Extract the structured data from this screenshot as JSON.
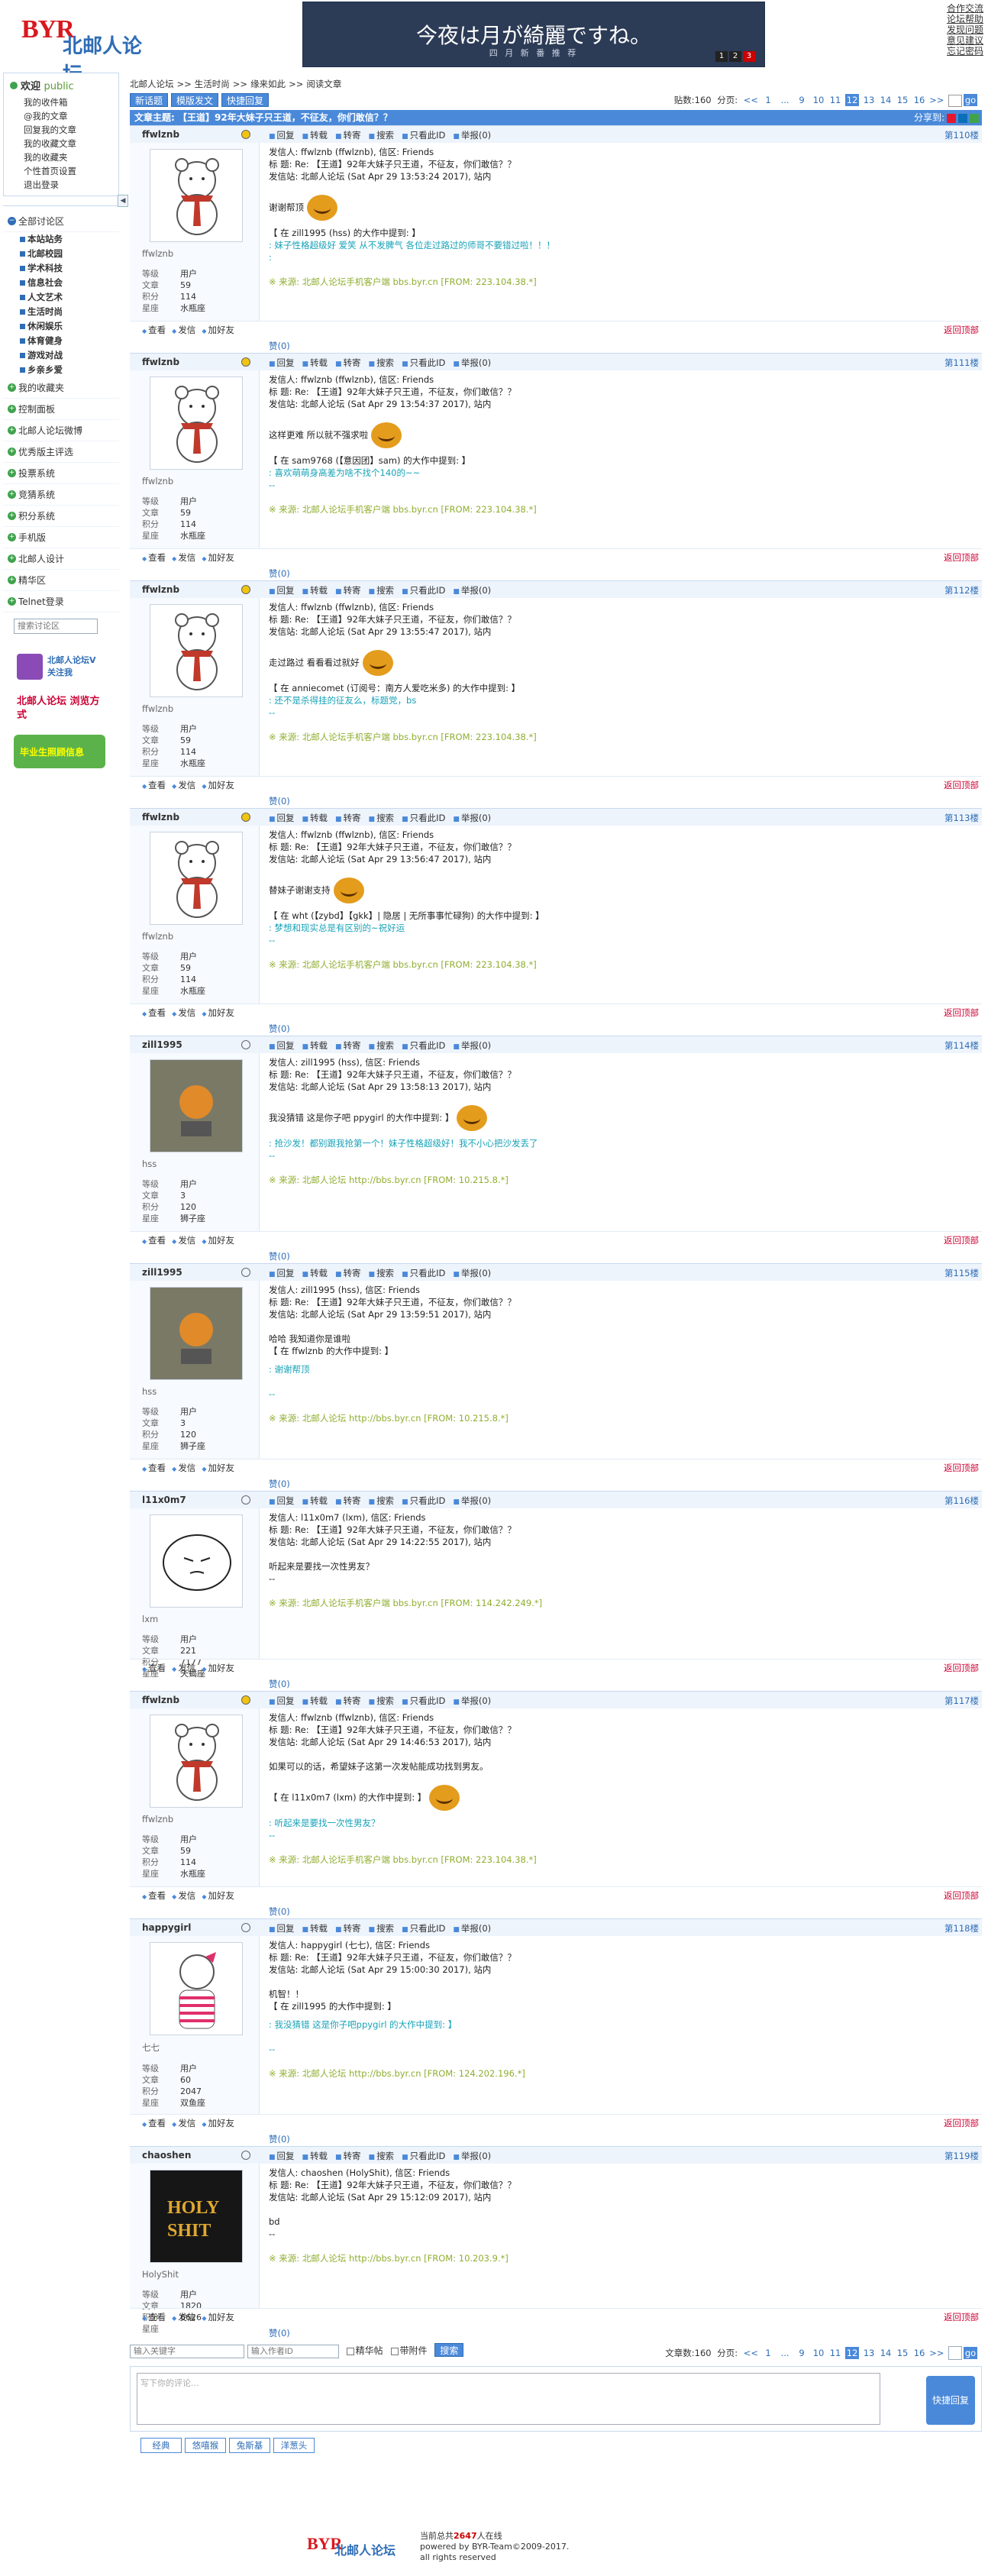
{
  "header": {
    "logo_text": "BYR",
    "logo_cn": "北邮人论坛",
    "banner_title": "今夜は月が綺麗ですね。",
    "banner_sub": "四 月 新 番 推 荐",
    "banner_pages": [
      "1",
      "2",
      "3"
    ],
    "top_links": [
      "合作交流",
      "论坛帮助",
      "发现问题",
      "意见建议",
      "忘记密码"
    ]
  },
  "sidebar": {
    "welcome": "欢迎",
    "user": "public",
    "user_menu": [
      "我的收件箱",
      "@我的文章",
      "回复我的文章",
      "我的收藏文章",
      "我的收藏夹",
      "个性首页设置",
      "退出登录"
    ],
    "collapse": "◀",
    "nav_all": "全部讨论区",
    "sections": [
      "本站站务",
      "北邮校园",
      "学术科技",
      "信息社会",
      "人文艺术",
      "生活时尚",
      "休闲娱乐",
      "体育健身",
      "游戏对战",
      "乡亲乡爱"
    ],
    "nav_items": [
      "我的收藏夹",
      "控制面板",
      "北邮人论坛微博",
      "优秀版主评选",
      "投票系统",
      "竞猜系统",
      "积分系统",
      "手机版",
      "北邮人设计",
      "精华区",
      "Telnet登录"
    ],
    "search_placeholder": "搜索讨论区",
    "promos": [
      "北邮人论坛V 关注我",
      "北邮人论坛 浏览方式",
      "毕业生照顾信息"
    ]
  },
  "main": {
    "breadcrumb": [
      "北邮人论坛",
      ">>",
      "生活时尚",
      ">>",
      "缘来如此",
      ">>",
      "阅读文章"
    ],
    "buttons": [
      "新话题",
      "模版发文",
      "快捷回复"
    ],
    "post_count": "贴数:160",
    "paging_label": "分页:",
    "pages": [
      "<<",
      "1",
      "...",
      "9",
      "10",
      "11",
      "12",
      "13",
      "14",
      "15",
      "16",
      ">>"
    ],
    "current_page": "12",
    "go": "go",
    "title_prefix": "文章主题:",
    "title": "【王道】92年大妹子只王道，不征友，你们敢信？？",
    "share_label": "分享到:",
    "action_labels": [
      "回复",
      "转载",
      "转寄",
      "搜索",
      "只看此ID",
      "举报(0)"
    ],
    "foot_links": [
      "查看",
      "发信",
      "加好友"
    ],
    "like_label": "赞(0)",
    "to_top": "返回顶部",
    "prop_labels": [
      "等级",
      "文章",
      "积分",
      "星座"
    ]
  },
  "posts": [
    {
      "uid": "ffwlznb",
      "floor": "第110楼",
      "nick": "ffwlznb",
      "level": "用户",
      "posts": "59",
      "score": "114",
      "sign": "水瓶座",
      "status": "online",
      "lines": [
        "发信人: ffwlznb (ffwlznb), 信区: Friends",
        "标  题: Re: 【王道】92年大妹子只王道，不征友，你们敢信？？",
        "发信站: 北邮人论坛 (Sat Apr 29 13:53:24 2017), 站内",
        "",
        "谢谢帮顶"
      ],
      "quote": [
        "【 在 zill1995 (hss) 的大作中提到: 】",
        ": 妹子性格超级好 爱笑 从不发脾气 各位走过路过的师哥不要错过啦！！！",
        ":"
      ],
      "source": "※ 来源: 北邮人论坛手机客户端 bbs.byr.cn [FROM: 223.104.38.*]"
    },
    {
      "uid": "ffwlznb",
      "floor": "第111楼",
      "nick": "ffwlznb",
      "level": "用户",
      "posts": "59",
      "score": "114",
      "sign": "水瓶座",
      "status": "online",
      "lines": [
        "发信人: ffwlznb (ffwlznb), 信区: Friends",
        "标  题: Re: 【王道】92年大妹子只王道，不征友，你们敢信？？",
        "发信站: 北邮人论坛 (Sat Apr 29 13:54:37 2017), 站内",
        "",
        "这样更难 所以就不强求啦"
      ],
      "quote": [
        "【 在 sam9768 (【意因团】sam) 的大作中提到: 】",
        ": 喜欢萌萌身高差为啥不找个140的~~",
        "--"
      ],
      "source": "※ 来源: 北邮人论坛手机客户端 bbs.byr.cn [FROM: 223.104.38.*]"
    },
    {
      "uid": "ffwlznb",
      "floor": "第112楼",
      "nick": "ffwlznb",
      "level": "用户",
      "posts": "59",
      "score": "114",
      "sign": "水瓶座",
      "status": "online",
      "lines": [
        "发信人: ffwlznb (ffwlznb), 信区: Friends",
        "标  题: Re: 【王道】92年大妹子只王道，不征友，你们敢信？？",
        "发信站: 北邮人论坛 (Sat Apr 29 13:55:47 2017), 站内",
        "",
        "走过路过 看看看过就好"
      ],
      "quote": [
        "【 在 anniecomet (订阅号：南方人爱吃米多) 的大作中提到: 】",
        ": 还不是杀得挂的征友么，标题党，bs",
        "--"
      ],
      "source": "※ 来源: 北邮人论坛手机客户端 bbs.byr.cn [FROM: 223.104.38.*]"
    },
    {
      "uid": "ffwlznb",
      "floor": "第113楼",
      "nick": "ffwlznb",
      "level": "用户",
      "posts": "59",
      "score": "114",
      "sign": "水瓶座",
      "status": "online",
      "lines": [
        "发信人: ffwlznb (ffwlznb), 信区: Friends",
        "标  题: Re: 【王道】92年大妹子只王道，不征友，你们敢信？？",
        "发信站: 北邮人论坛 (Sat Apr 29 13:56:47 2017), 站内",
        "",
        "替妹子谢谢支持"
      ],
      "quote": [
        "【 在 wht (【zybd】【gkk】| 隐居 | 无所事事忙碌狗) 的大作中提到: 】",
        ": 梦想和现实总是有区别的~祝好运",
        "--"
      ],
      "source": "※ 来源: 北邮人论坛手机客户端 bbs.byr.cn [FROM: 223.104.38.*]"
    },
    {
      "uid": "zill1995",
      "floor": "第114楼",
      "nick": "hss",
      "level": "用户",
      "posts": "3",
      "score": "120",
      "sign": "狮子座",
      "status": "hand",
      "lines": [
        "发信人: zill1995 (hss), 信区: Friends",
        "标  题: Re: 【王道】92年大妹子只王道，不征友，你们敢信？？",
        "发信站: 北邮人论坛 (Sat Apr 29 13:58:13 2017), 站内",
        "",
        "我没猜错 这是你子吧       ppygirl 的大作中提到: 】"
      ],
      "quote": [
        ": 抢沙发！都别跟我抢第一个！妹子性格超级好！我不小心把沙发丢了",
        "--"
      ],
      "source": "※ 来源: 北邮人论坛 http://bbs.byr.cn [FROM: 10.215.8.*]"
    },
    {
      "uid": "zill1995",
      "floor": "第115楼",
      "nick": "hss",
      "level": "用户",
      "posts": "3",
      "score": "120",
      "sign": "狮子座",
      "status": "hand",
      "lines": [
        "发信人: zill1995 (hss), 信区: Friends",
        "标  题: Re: 【王道】92年大妹子只王道，不征友，你们敢信？？",
        "发信站: 北邮人论坛 (Sat Apr 29 13:59:51 2017), 站内",
        "",
        "哈哈 我知道你是谁啦",
        "【 在 ffwlznb 的大作中提到: 】"
      ],
      "quote": [
        ": 谢谢帮顶",
        "",
        "--"
      ],
      "source": "※ 来源: 北邮人论坛 http://bbs.byr.cn [FROM: 10.215.8.*]"
    },
    {
      "uid": "l11x0m7",
      "floor": "第116楼",
      "nick": "lxm",
      "level": "用户",
      "posts": "221",
      "score": "7177",
      "sign": "天蝎座",
      "status": "hand",
      "lines": [
        "发信人: l11x0m7 (lxm), 信区: Friends",
        "标  题: Re: 【王道】92年大妹子只王道，不征友，你们敢信？？",
        "发信站: 北邮人论坛 (Sat Apr 29 14:22:55 2017), 站内",
        "",
        "听起来是要找一次性男友？",
        "--"
      ],
      "quote": [],
      "source": "※ 来源: 北邮人论坛手机客户端 bbs.byr.cn [FROM: 114.242.249.*]"
    },
    {
      "uid": "ffwlznb",
      "floor": "第117楼",
      "nick": "ffwlznb",
      "level": "用户",
      "posts": "59",
      "score": "114",
      "sign": "水瓶座",
      "status": "online",
      "lines": [
        "发信人: ffwlznb (ffwlznb), 信区: Friends",
        "标  题: Re: 【王道】92年大妹子只王道，不征友，你们敢信？？",
        "发信站: 北邮人论坛 (Sat Apr 29 14:46:53 2017), 站内",
        "",
        "如果可以的话，希望妹子这第一次发帖能成功找到男友。",
        "",
        "【 在 l11x0m7 (lxm) 的大作中提到: 】"
      ],
      "quote": [
        ": 听起来是要找一次性男友？",
        "--"
      ],
      "source": "※ 来源: 北邮人论坛手机客户端 bbs.byr.cn [FROM: 223.104.38.*]"
    },
    {
      "uid": "happygirl",
      "floor": "第118楼",
      "nick": "七七",
      "level": "用户",
      "posts": "60",
      "score": "2047",
      "sign": "双鱼座",
      "status": "hand",
      "lines": [
        "发信人: happygirl (七七), 信区: Friends",
        "标  题: Re: 【王道】92年大妹子只王道，不征友，你们敢信？？",
        "发信站: 北邮人论坛 (Sat Apr 29 15:00:30 2017), 站内",
        "",
        "机智！！",
        "【 在 zill1995 的大作中提到: 】"
      ],
      "quote": [
        ": 我没猜错 这是你子吧ppygirl 的大作中提到: 】",
        "",
        "--"
      ],
      "source": "※ 来源: 北邮人论坛 http://bbs.byr.cn [FROM: 124.202.196.*]"
    },
    {
      "uid": "chaoshen",
      "floor": "第119楼",
      "nick": "HolyShit",
      "level": "用户",
      "posts": "1820",
      "score": "6626",
      "sign": "",
      "status": "smile",
      "lines": [
        "发信人: chaoshen (HolyShit), 信区: Friends",
        "标  题: Re: 【王道】92年大妹子只王道，不征友，你们敢信？？",
        "发信站: 北邮人论坛 (Sat Apr 29 15:12:09 2017), 站内",
        "",
        "bd",
        "--"
      ],
      "quote": [],
      "source": "※ 来源: 北邮人论坛 http://bbs.byr.cn [FROM: 10.203.9.*]"
    }
  ],
  "bottom": {
    "search_kw_placeholder": "输入关键字",
    "search_id_placeholder": "输入作者ID",
    "elite_label": "精华帖",
    "attach_label": "带附件",
    "search_btn": "搜索",
    "article_count": "文章数:160"
  },
  "reply": {
    "placeholder": "写下你的评论...",
    "submit": "快捷回复",
    "emo_tabs": [
      "经典",
      "悠嘻猴",
      "兔斯基",
      "洋葱头"
    ]
  },
  "footer": {
    "online_prefix": "当前总共",
    "online_count": "2647",
    "online_suffix": "人在线",
    "powered": "powered by BYR-Team©2009-2017.",
    "rights": "all rights reserved"
  }
}
